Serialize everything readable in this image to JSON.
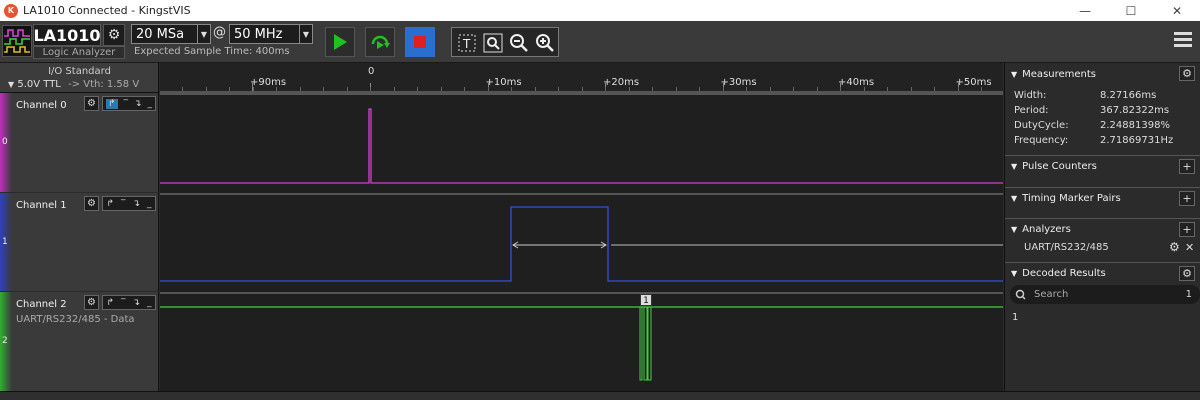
{
  "window": {
    "title": "LA1010 Connected - KingstVIS"
  },
  "toolbar": {
    "device_name": "LA1010",
    "device_subtitle": "Logic Analyzer",
    "sample_depth": "20 MSa",
    "at_symbol": "@",
    "sample_rate": "50 MHz",
    "expected_time": "Expected Sample Time: 400ms"
  },
  "io": {
    "title": "I/O Standard",
    "voltage": "5.0V TTL",
    "vth": "-> Vth: 1.58 V"
  },
  "ruler": {
    "labels": [
      {
        "text": "+90ms",
        "t": -90
      },
      {
        "text": "0",
        "t": 0
      },
      {
        "text": "+10ms",
        "t": 10
      },
      {
        "text": "+20ms",
        "t": 20
      },
      {
        "text": "+30ms",
        "t": 30
      },
      {
        "text": "+40ms",
        "t": 40
      },
      {
        "text": "+50ms",
        "t": 50
      }
    ]
  },
  "channels": [
    {
      "index": "0",
      "name": "Channel 0",
      "color": "#c040c0",
      "sub": ""
    },
    {
      "index": "1",
      "name": "Channel 1",
      "color": "#3040c0",
      "sub": ""
    },
    {
      "index": "2",
      "name": "Channel 2",
      "color": "#30b030",
      "sub": "UART/RS232/485 - Data"
    }
  ],
  "colors": {
    "ch0_wave": "#d040d0",
    "ch1_wave": "#3050e0",
    "ch2_wave": "#40d040",
    "play": "#20c020",
    "stop": "#e02020"
  },
  "decoded_marker": "1",
  "panel": {
    "measurements": {
      "title": "Measurements",
      "rows": [
        {
          "label": "Width:",
          "value": "8.27166ms"
        },
        {
          "label": "Period:",
          "value": "367.82322ms"
        },
        {
          "label": "DutyCycle:",
          "value": "2.24881398%"
        },
        {
          "label": "Frequency:",
          "value": "2.71869731Hz"
        }
      ]
    },
    "pulse_counters": "Pulse Counters",
    "timing_markers": "Timing Marker Pairs",
    "analyzers": {
      "title": "Analyzers",
      "item": "UART/RS232/485"
    },
    "decoded": {
      "title": "Decoded Results",
      "search_placeholder": "Search",
      "count": "1",
      "first_result": "1"
    }
  }
}
